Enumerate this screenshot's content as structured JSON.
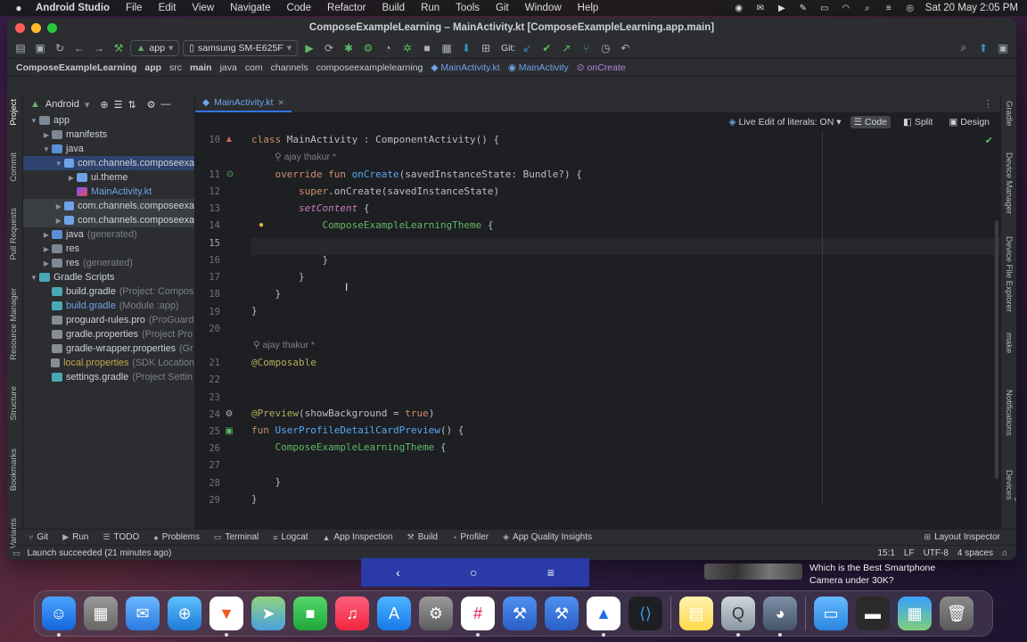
{
  "menubar": {
    "app_name": "Android Studio",
    "items": [
      "File",
      "Edit",
      "View",
      "Navigate",
      "Code",
      "Refactor",
      "Build",
      "Run",
      "Tools",
      "Git",
      "Window",
      "Help"
    ],
    "datetime": "Sat 20 May  2:05 PM"
  },
  "window": {
    "title": "ComposeExampleLearning – MainActivity.kt [ComposeExampleLearning.app.main]"
  },
  "toolbar": {
    "run_config": "app",
    "device": "samsung SM-E625F",
    "git_label": "Git:"
  },
  "breadcrumb": [
    "ComposeExampleLearning",
    "app",
    "src",
    "main",
    "java",
    "com",
    "channels",
    "composeexamplelearning",
    "MainActivity.kt",
    "MainActivity",
    "onCreate"
  ],
  "left_tool_tabs": [
    "Project",
    "Commit",
    "Pull Requests",
    "Resource Manager",
    "Structure",
    "Bookmarks",
    "Variants"
  ],
  "right_tool_tabs": [
    "Gradle",
    "Device Manager",
    "Device File Explorer",
    "make",
    "Notifications",
    "Running Devices"
  ],
  "project": {
    "view_label": "Android",
    "tree": [
      {
        "label": "app",
        "level": 0,
        "icon": "folder",
        "expanded": true
      },
      {
        "label": "manifests",
        "level": 1,
        "icon": "folder",
        "expanded": false
      },
      {
        "label": "java",
        "level": 1,
        "icon": "folder-blue",
        "expanded": true
      },
      {
        "label": "com.channels.composeexa",
        "level": 2,
        "icon": "folder-package",
        "expanded": true,
        "selected": true
      },
      {
        "label": "ui.theme",
        "level": 3,
        "icon": "folder-package",
        "expanded": false
      },
      {
        "label": "MainActivity.kt",
        "level": 3,
        "icon": "kotlin-file",
        "blue": true
      },
      {
        "label": "com.channels.composeexa",
        "level": 2,
        "icon": "folder-package",
        "expanded": false,
        "highlight": true
      },
      {
        "label": "com.channels.composeexa",
        "level": 2,
        "icon": "folder-package",
        "expanded": false,
        "highlight": true
      },
      {
        "label": "java",
        "suffix": "(generated)",
        "level": 1,
        "icon": "folder-blue",
        "expanded": false
      },
      {
        "label": "res",
        "level": 1,
        "icon": "folder",
        "expanded": false
      },
      {
        "label": "res",
        "suffix": "(generated)",
        "level": 1,
        "icon": "folder",
        "expanded": false
      },
      {
        "label": "Gradle Scripts",
        "level": 0,
        "icon": "gradle",
        "expanded": true
      },
      {
        "label": "build.gradle",
        "suffix": "(Project: Compos",
        "level": 1,
        "icon": "gradle"
      },
      {
        "label": "build.gradle",
        "suffix": "(Module :app)",
        "level": 1,
        "icon": "gradle",
        "blue": true
      },
      {
        "label": "proguard-rules.pro",
        "suffix": "(ProGuard",
        "level": 1,
        "icon": "properties"
      },
      {
        "label": "gradle.properties",
        "suffix": "(Project Pro",
        "level": 1,
        "icon": "properties"
      },
      {
        "label": "gradle-wrapper.properties",
        "suffix": "(Gr",
        "level": 1,
        "icon": "properties"
      },
      {
        "label": "local.properties",
        "suffix": "(SDK Location",
        "level": 1,
        "icon": "properties",
        "yellow": true
      },
      {
        "label": "settings.gradle",
        "suffix": "(Project Settin",
        "level": 1,
        "icon": "gradle"
      }
    ]
  },
  "editor": {
    "tab_label": "MainActivity.kt",
    "live_edit": "Live Edit of literals: ON",
    "modes": [
      "Code",
      "Split",
      "Design"
    ],
    "author_hint": "ajay thakur *",
    "line_numbers": [
      "10",
      "11",
      "12",
      "13",
      "14",
      "15",
      "16",
      "17",
      "18",
      "19",
      "20",
      "21",
      "22",
      "23",
      "24",
      "25",
      "26",
      "27",
      "28",
      "29"
    ]
  },
  "bottom_tools": [
    "Git",
    "Run",
    "TODO",
    "Problems",
    "Terminal",
    "Logcat",
    "App Inspection",
    "Build",
    "Profiler",
    "App Quality Insights"
  ],
  "layout_inspector": "Layout Inspector",
  "status": {
    "message": "Launch succeeded (21 minutes ago)",
    "position": "15:1",
    "line_sep": "LF",
    "encoding": "UTF-8",
    "indent": "4 spaces"
  },
  "notification": {
    "text1": "Which is the Best Smartphone",
    "text2": "Camera under 30K?"
  },
  "colors": {
    "accent": "#3574f0",
    "keyword": "#cf8e6d",
    "function": "#56a8f5",
    "annotation": "#b3ae60",
    "string": "#6aab73"
  }
}
